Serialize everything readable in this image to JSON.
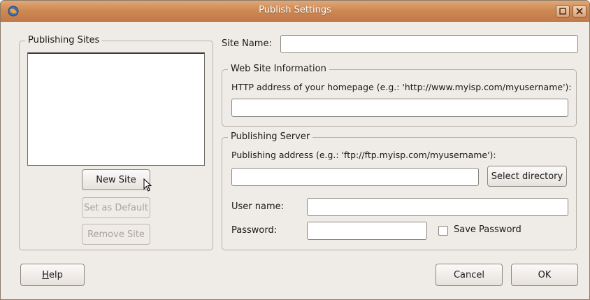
{
  "window": {
    "title": "Publish Settings"
  },
  "publishing_sites": {
    "legend": "Publishing Sites",
    "sites": [],
    "new_site_label": "New Site",
    "set_default_label": "Set as Default",
    "remove_site_label": "Remove Site"
  },
  "site_name": {
    "label": "Site Name:",
    "value": ""
  },
  "web_site_info": {
    "legend": "Web Site Information",
    "http_label": "HTTP address of your homepage (e.g.: 'http://www.myisp.com/myusername'):",
    "http_value": ""
  },
  "publishing_server": {
    "legend": "Publishing Server",
    "address_label": "Publishing address (e.g.: 'ftp://ftp.myisp.com/myusername'):",
    "address_value": "",
    "select_directory_label": "Select directory",
    "username_label": "User name:",
    "username_value": "",
    "password_label": "Password:",
    "password_value": "",
    "save_password_label": "Save Password",
    "save_password_checked": false
  },
  "footer": {
    "help_mnemonic": "H",
    "help_rest": "elp",
    "cancel_label": "Cancel",
    "ok_label": "OK"
  },
  "icons": {
    "app": "app-globe-icon",
    "maximize": "maximize-icon",
    "close": "close-icon",
    "cursor": "mouse-pointer-icon"
  },
  "colors": {
    "titlebar": "#cf8a55",
    "window_bg": "#efebe7"
  }
}
